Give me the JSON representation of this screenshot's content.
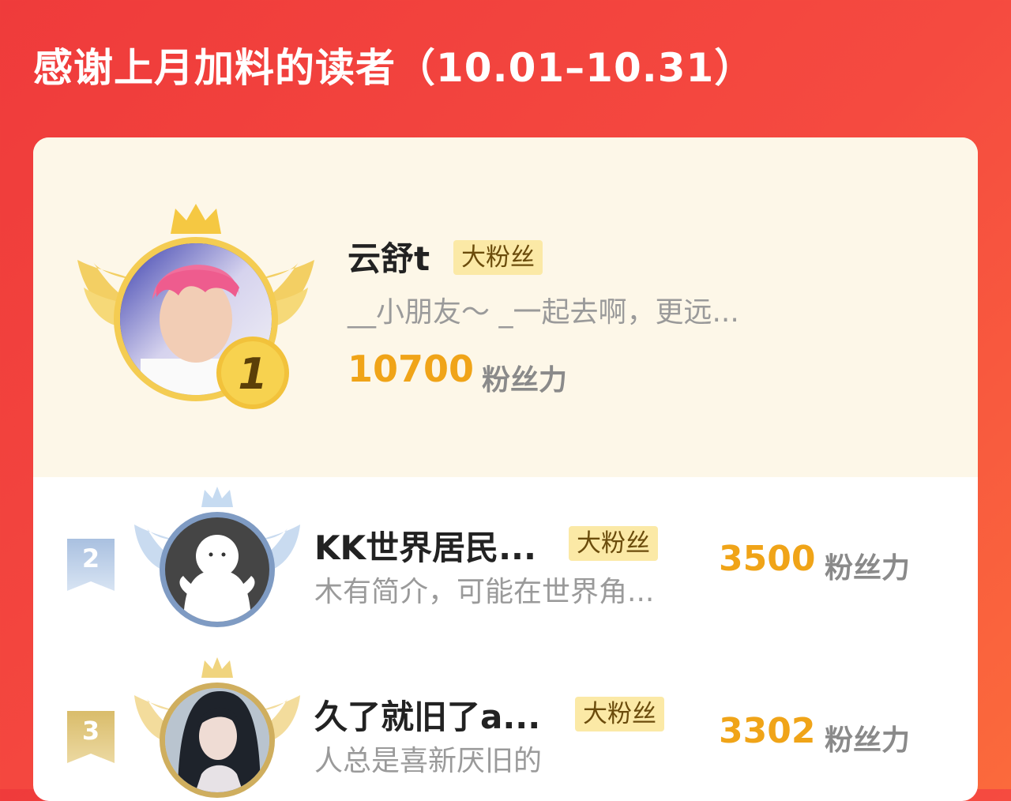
{
  "title": "感谢上月加料的读者（10.01–10.31）",
  "colors": {
    "background": "#f1433e",
    "gold": "#f0a418",
    "badge_bg": "#fbe9a6",
    "top_section_bg": "#fdf7e8"
  },
  "leaders": [
    {
      "rank": "1",
      "name": "云舒t",
      "badge": "大粉丝",
      "bio": "__小朋友～ _一起去啊，更远...",
      "score": "10700",
      "score_unit": "粉丝力",
      "avatar": "pink-hair-photo"
    },
    {
      "rank": "2",
      "name": "KK世界居民...",
      "badge": "大粉丝",
      "bio": "木有简介，可能在世界角...",
      "score": "3500",
      "score_unit": "粉丝力",
      "avatar": "default-ghost-avatar"
    },
    {
      "rank": "3",
      "name": "久了就旧了a...",
      "badge": "大粉丝",
      "bio": "人总是喜新厌旧的",
      "score": "3302",
      "score_unit": "粉丝力",
      "avatar": "anime-girl-avatar"
    }
  ]
}
